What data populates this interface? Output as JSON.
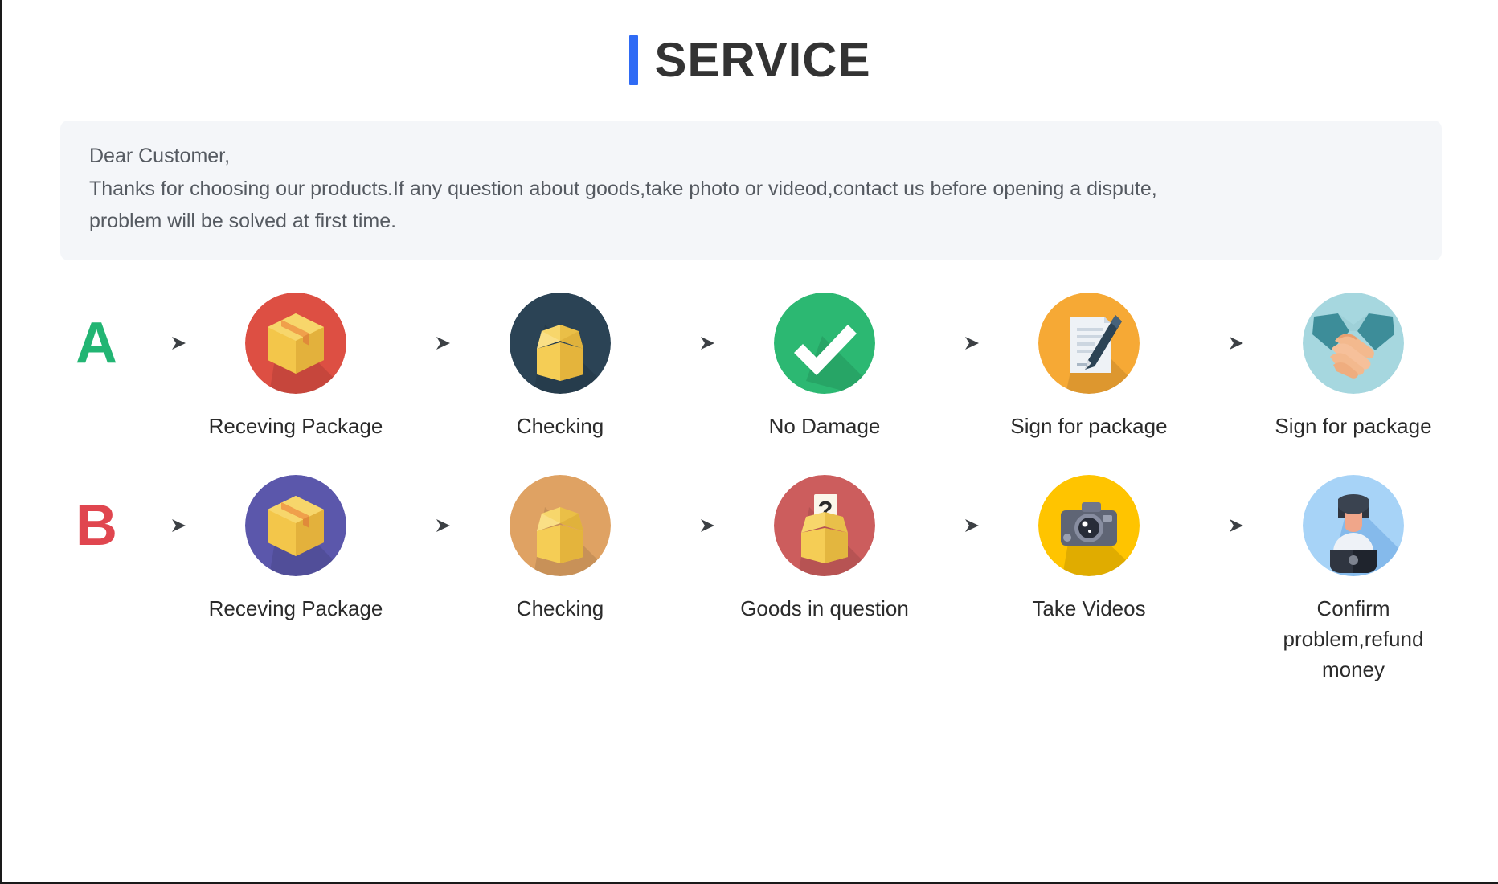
{
  "header": {
    "accent_color": "#2f6bf5",
    "title": "SERVICE"
  },
  "notice": {
    "line1": "Dear Customer,",
    "line2": "Thanks for choosing our products.If any question about goods,take photo or videod,contact us before opening a dispute,",
    "line3": "problem will be solved at first time.",
    "background": "#f4f6f9"
  },
  "flows": [
    {
      "letter": "A",
      "letter_color": "#22b573",
      "arrow_icon": "arrow-right-icon",
      "steps": [
        {
          "icon": "package-box-icon",
          "circle_color": "#dd4f43",
          "label": "Receving Package"
        },
        {
          "icon": "open-box-icon",
          "circle_color": "#2b4355",
          "label": "Checking"
        },
        {
          "icon": "check-mark-icon",
          "circle_color": "#2cb872",
          "label": "No Damage"
        },
        {
          "icon": "sign-document-icon",
          "circle_color": "#f6a935",
          "label": "Sign for package"
        },
        {
          "icon": "handshake-icon",
          "circle_color": "#a6d7df",
          "label": "Sign for package"
        }
      ]
    },
    {
      "letter": "B",
      "letter_color": "#e0464f",
      "arrow_icon": "arrow-right-icon",
      "steps": [
        {
          "icon": "package-box-icon",
          "circle_color": "#5b57ab",
          "label": "Receving Package"
        },
        {
          "icon": "open-box-icon",
          "circle_color": "#dfa263",
          "label": "Checking"
        },
        {
          "icon": "question-box-icon",
          "circle_color": "#cc5d5d",
          "label": "Goods in question"
        },
        {
          "icon": "camera-icon",
          "circle_color": "#ffc400",
          "label": "Take Videos"
        },
        {
          "icon": "support-agent-icon",
          "circle_color": "#a7d3f7",
          "label": "Confirm problem,refund money"
        }
      ]
    }
  ]
}
